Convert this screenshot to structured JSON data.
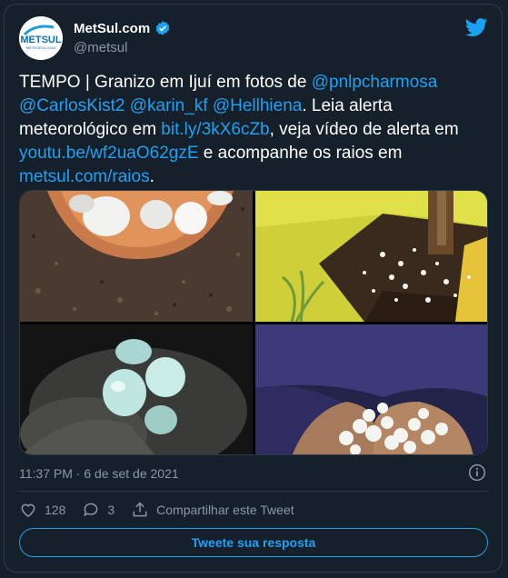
{
  "account": {
    "display_name": "MetSul.com",
    "handle": "@metsul",
    "avatar_text": "METSUL",
    "avatar_subtext": "METEOROLOGIA"
  },
  "tweet": {
    "text_1": "TEMPO | Granizo em Ijuí em fotos de ",
    "mention_1": "@pnlpcharmosa",
    "mention_2": "@CarlosKist2",
    "mention_3": "@karin_kf",
    "mention_4": "@Hellhiena",
    "text_2": ". Leia alerta meteorológico em ",
    "link_1": "bit.ly/3kX6cZb",
    "text_3": ", veja vídeo de alerta em ",
    "link_2": "youtu.be/wf2uaO62gzE",
    "text_4": " e acompanhe os raios em ",
    "link_3": "metsul.com/raios",
    "text_5": "."
  },
  "timestamp": "11:37 PM · 6 de set de 2021",
  "actions": {
    "likes": "128",
    "replies": "3",
    "share_label": "Compartilhar este Tweet"
  },
  "reply_button_label": "Tweete sua resposta",
  "colors": {
    "background": "#15202b",
    "accent": "#1da1f2",
    "secondary_text": "#8899a6",
    "border": "#2f3b47"
  }
}
